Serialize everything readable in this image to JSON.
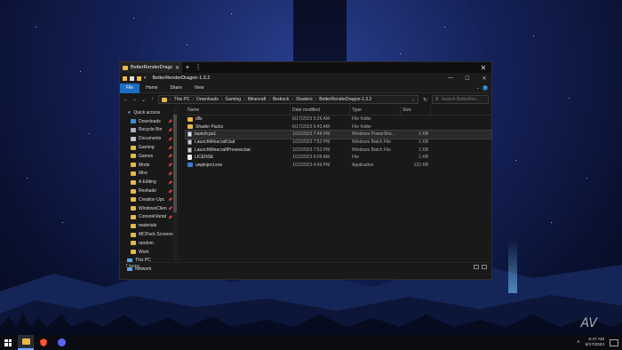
{
  "window": {
    "tab_title": "BetterRenderDragon-1.3.2",
    "title": "BetterRenderDragon-1.3.2",
    "new_tab": "+",
    "close": "✕",
    "minimize": "—",
    "maximize": "☐"
  },
  "ribbon": {
    "tabs": [
      "File",
      "Home",
      "Share",
      "View"
    ]
  },
  "address": {
    "crumbs": [
      "This PC",
      "Downloads",
      "Gaming",
      "Minecraft",
      "Bedrock",
      "Shaders",
      "BetterRenderDragon-1.3.2"
    ]
  },
  "search": {
    "placeholder": "Search BetterRen..."
  },
  "nav": {
    "quick_access": "Quick access",
    "items": [
      {
        "label": "Downloads",
        "icon": "download-icon",
        "color": "#3a8fd8"
      },
      {
        "label": "Recycle Bin",
        "icon": "recycle-bin-icon",
        "color": "#a8b4c4"
      },
      {
        "label": "Documents",
        "icon": "documents-icon",
        "color": "#b9c2cf"
      },
      {
        "label": "Gaming",
        "icon": "folder-icon",
        "color": "#e8b84a"
      },
      {
        "label": "Games",
        "icon": "folder-icon",
        "color": "#e8b84a"
      },
      {
        "label": "Mods",
        "icon": "folder-icon",
        "color": "#e8b84a"
      },
      {
        "label": "Misc",
        "icon": "folder-icon",
        "color": "#e8b84a"
      },
      {
        "label": "A Editing",
        "icon": "folder-icon",
        "color": "#e8b84a"
      },
      {
        "label": "Reshade",
        "icon": "folder-icon",
        "color": "#e8b84a"
      },
      {
        "label": "Creation Upc",
        "icon": "folder-icon",
        "color": "#e8b84a"
      },
      {
        "label": "WindowsClien",
        "icon": "folder-icon",
        "color": "#e8b84a"
      },
      {
        "label": "ConsoleVariat",
        "icon": "folder-icon",
        "color": "#e8b84a"
      },
      {
        "label": "materials",
        "icon": "folder-icon",
        "color": "#e8b84a"
      },
      {
        "label": "MCPack Screens",
        "icon": "folder-icon",
        "color": "#e8b84a"
      },
      {
        "label": "random",
        "icon": "folder-icon",
        "color": "#e8b84a"
      },
      {
        "label": "Work",
        "icon": "folder-icon",
        "color": "#e8b84a"
      }
    ],
    "this_pc": "This PC",
    "network": "Network"
  },
  "columns": {
    "name": "Name",
    "date": "Date modified",
    "type": "Type",
    "size": "Size"
  },
  "files": [
    {
      "name": "dlls",
      "date": "6/17/2023 5:26 AM",
      "type": "File folder",
      "size": "",
      "icon": "folder"
    },
    {
      "name": "Shader Packs",
      "date": "6/17/2023 6:43 AM",
      "type": "File folder",
      "size": "",
      "icon": "folder"
    },
    {
      "name": "launch.ps1",
      "date": "1/22/2023 7:48 PM",
      "type": "Windows PowerShe...",
      "size": "1 KB",
      "icon": "ps1"
    },
    {
      "name": "LaunchMinecraft.bat",
      "date": "1/22/2023 7:52 PM",
      "type": "Windows Batch File",
      "size": "1 KB",
      "icon": "bat"
    },
    {
      "name": "LaunchMinecraftPreview.bat",
      "date": "1/22/2023 7:53 PM",
      "type": "Windows Batch File",
      "size": "1 KB",
      "icon": "bat"
    },
    {
      "name": "LICENSE",
      "date": "1/22/2023 6:09 AM",
      "type": "File",
      "size": "1 KB",
      "icon": "file"
    },
    {
      "name": "uwpinject.exe",
      "date": "1/22/2023 4:49 PM",
      "type": "Application",
      "size": "122 KB",
      "icon": "exe"
    }
  ],
  "status": {
    "count": "7 items"
  },
  "taskbar": {
    "time": "6:47 AM",
    "date": "6/17/2023"
  },
  "colors": {
    "accent": "#1a6fc4",
    "folder": "#e8b84a"
  }
}
